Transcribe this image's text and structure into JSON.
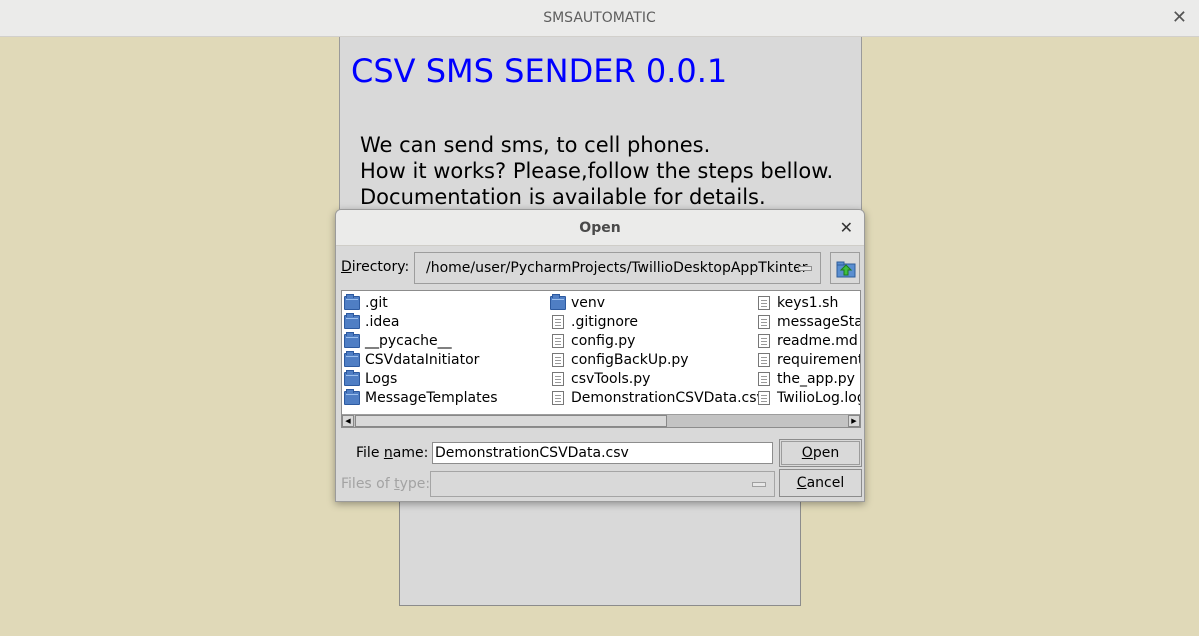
{
  "window": {
    "title": "SMSAUTOMATIC",
    "close_glyph": "✕"
  },
  "app": {
    "heading": "CSV SMS SENDER 0.0.1",
    "heading_color": "#0000ff",
    "description": [
      "We can send sms, to cell phones.",
      "How it works? Please,follow the steps bellow.",
      "Documentation is available for details."
    ]
  },
  "dialog": {
    "title": "Open",
    "close_glyph": "✕",
    "directory_label_mnemonic": "D",
    "directory_label_rest": "irectory:",
    "directory_value": "/home/user/PycharmProjects/TwillioDesktopAppTkinter",
    "up_button_icon": "folder-up-icon",
    "files": {
      "column1": [
        {
          "name": ".git",
          "type": "folder"
        },
        {
          "name": ".idea",
          "type": "folder"
        },
        {
          "name": "__pycache__",
          "type": "folder"
        },
        {
          "name": "CSVdataInitiator",
          "type": "folder"
        },
        {
          "name": "Logs",
          "type": "folder"
        },
        {
          "name": "MessageTemplates",
          "type": "folder"
        }
      ],
      "column2": [
        {
          "name": "venv",
          "type": "folder"
        },
        {
          "name": ".gitignore",
          "type": "file"
        },
        {
          "name": "config.py",
          "type": "file"
        },
        {
          "name": "configBackUp.py",
          "type": "file"
        },
        {
          "name": "csvTools.py",
          "type": "file"
        },
        {
          "name": "DemonstrationCSVData.csv",
          "type": "file"
        }
      ],
      "column3": [
        {
          "name": "keys1.sh",
          "type": "file"
        },
        {
          "name": "messageStat",
          "type": "file"
        },
        {
          "name": "readme.md",
          "type": "file"
        },
        {
          "name": "requirements",
          "type": "file"
        },
        {
          "name": "the_app.py",
          "type": "file"
        },
        {
          "name": "TwilioLog.log",
          "type": "file"
        }
      ]
    },
    "scroll_left_glyph": "◀",
    "scroll_right_glyph": "▶",
    "file_name_label_pre": "File ",
    "file_name_label_mnemonic": "n",
    "file_name_label_post": "ame:",
    "file_name_value": "DemonstrationCSVData.csv",
    "files_of_type_label_pre": "Files of ",
    "files_of_type_label_mnemonic": "t",
    "files_of_type_label_post": "ype:",
    "open_mnemonic": "O",
    "open_rest": "pen",
    "cancel_mnemonic": "C",
    "cancel_rest": "ancel"
  }
}
